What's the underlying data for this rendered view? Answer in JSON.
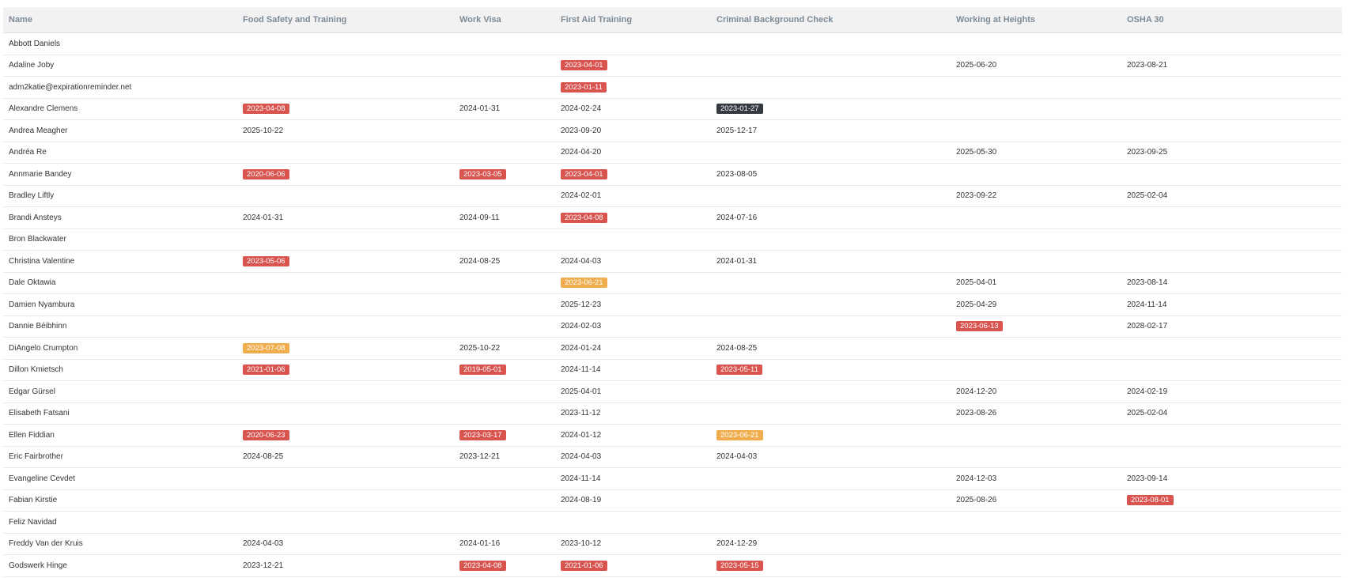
{
  "columns": [
    "Name",
    "Food Safety and Training",
    "Work Visa",
    "First Aid Training",
    "Criminal Background Check",
    "Working at Heights",
    "OSHA 30"
  ],
  "colors": {
    "red": "#d9534f",
    "orange": "#f0ad4e",
    "dark": "#343a40"
  },
  "rows": [
    {
      "name": "Abbott Daniels",
      "cells": [
        null,
        null,
        null,
        null,
        null,
        null
      ]
    },
    {
      "name": "Adaline Joby",
      "cells": [
        null,
        null,
        {
          "v": "2023-04-01",
          "s": "red"
        },
        null,
        {
          "v": "2025-06-20"
        },
        {
          "v": "2023-08-21"
        }
      ]
    },
    {
      "name": "adm2katie@expirationreminder.net",
      "cells": [
        null,
        null,
        {
          "v": "2023-01-11",
          "s": "red"
        },
        null,
        null,
        null
      ]
    },
    {
      "name": "Alexandre Clemens",
      "cells": [
        {
          "v": "2023-04-08",
          "s": "red"
        },
        {
          "v": "2024-01-31"
        },
        {
          "v": "2024-02-24"
        },
        {
          "v": "2023-01-27",
          "s": "dark"
        },
        null,
        null
      ]
    },
    {
      "name": "Andrea Meagher",
      "cells": [
        {
          "v": "2025-10-22"
        },
        null,
        {
          "v": "2023-09-20"
        },
        {
          "v": "2025-12-17"
        },
        null,
        null
      ]
    },
    {
      "name": "Andréa Re",
      "cells": [
        null,
        null,
        {
          "v": "2024-04-20"
        },
        null,
        {
          "v": "2025-05-30"
        },
        {
          "v": "2023-09-25"
        }
      ]
    },
    {
      "name": "Annmarie Bandey",
      "cells": [
        {
          "v": "2020-06-06",
          "s": "red"
        },
        {
          "v": "2023-03-05",
          "s": "red"
        },
        {
          "v": "2023-04-01",
          "s": "red"
        },
        {
          "v": "2023-08-05"
        },
        null,
        null
      ]
    },
    {
      "name": "Bradley Liftly",
      "cells": [
        null,
        null,
        {
          "v": "2024-02-01"
        },
        null,
        {
          "v": "2023-09-22"
        },
        {
          "v": "2025-02-04"
        }
      ]
    },
    {
      "name": "Brandi Ansteys",
      "cells": [
        {
          "v": "2024-01-31"
        },
        {
          "v": "2024-09-11"
        },
        {
          "v": "2023-04-08",
          "s": "red"
        },
        {
          "v": "2024-07-16"
        },
        null,
        null
      ]
    },
    {
      "name": "Bron Blackwater",
      "cells": [
        null,
        null,
        null,
        null,
        null,
        null
      ]
    },
    {
      "name": "Christina Valentine",
      "cells": [
        {
          "v": "2023-05-06",
          "s": "red"
        },
        {
          "v": "2024-08-25"
        },
        {
          "v": "2024-04-03"
        },
        {
          "v": "2024-01-31"
        },
        null,
        null
      ]
    },
    {
      "name": "Dale Oktawia",
      "cells": [
        null,
        null,
        {
          "v": "2023-06-21",
          "s": "orange"
        },
        null,
        {
          "v": "2025-04-01"
        },
        {
          "v": "2023-08-14"
        }
      ]
    },
    {
      "name": "Damien Nyambura",
      "cells": [
        null,
        null,
        {
          "v": "2025-12-23"
        },
        null,
        {
          "v": "2025-04-29"
        },
        {
          "v": "2024-11-14"
        }
      ]
    },
    {
      "name": "Dannie Béibhinn",
      "cells": [
        null,
        null,
        {
          "v": "2024-02-03"
        },
        null,
        {
          "v": "2023-06-13",
          "s": "red"
        },
        {
          "v": "2028-02-17"
        }
      ]
    },
    {
      "name": "DiAngelo Crumpton",
      "cells": [
        {
          "v": "2023-07-08",
          "s": "orange"
        },
        {
          "v": "2025-10-22"
        },
        {
          "v": "2024-01-24"
        },
        {
          "v": "2024-08-25"
        },
        null,
        null
      ]
    },
    {
      "name": "Dillon Kmietsch",
      "cells": [
        {
          "v": "2021-01-06",
          "s": "red"
        },
        {
          "v": "2019-05-01",
          "s": "red"
        },
        {
          "v": "2024-11-14"
        },
        {
          "v": "2023-05-11",
          "s": "red"
        },
        null,
        null
      ]
    },
    {
      "name": "Edgar Gürsel",
      "cells": [
        null,
        null,
        {
          "v": "2025-04-01"
        },
        null,
        {
          "v": "2024-12-20"
        },
        {
          "v": "2024-02-19"
        }
      ]
    },
    {
      "name": "Elisabeth Fatsani",
      "cells": [
        null,
        null,
        {
          "v": "2023-11-12"
        },
        null,
        {
          "v": "2023-08-26"
        },
        {
          "v": "2025-02-04"
        }
      ]
    },
    {
      "name": "Ellen Fiddian",
      "cells": [
        {
          "v": "2020-06-23",
          "s": "red"
        },
        {
          "v": "2023-03-17",
          "s": "red"
        },
        {
          "v": "2024-01-12"
        },
        {
          "v": "2023-06-21",
          "s": "orange"
        },
        null,
        null
      ]
    },
    {
      "name": "Eric Fairbrother",
      "cells": [
        {
          "v": "2024-08-25"
        },
        {
          "v": "2023-12-21"
        },
        {
          "v": "2024-04-03"
        },
        {
          "v": "2024-04-03"
        },
        null,
        null
      ]
    },
    {
      "name": "Evangeline Cevdet",
      "cells": [
        null,
        null,
        {
          "v": "2024-11-14"
        },
        null,
        {
          "v": "2024-12-03"
        },
        {
          "v": "2023-09-14"
        }
      ]
    },
    {
      "name": "Fabian Kirstie",
      "cells": [
        null,
        null,
        {
          "v": "2024-08-19"
        },
        null,
        {
          "v": "2025-08-26"
        },
        {
          "v": "2023-08-01",
          "s": "red"
        }
      ]
    },
    {
      "name": "Feliz Navidad",
      "cells": [
        null,
        null,
        null,
        null,
        null,
        null
      ]
    },
    {
      "name": "Freddy Van der Kruis",
      "cells": [
        {
          "v": "2024-04-03"
        },
        {
          "v": "2024-01-16"
        },
        {
          "v": "2023-10-12"
        },
        {
          "v": "2024-12-29"
        },
        null,
        null
      ]
    },
    {
      "name": "Godswerk Hinge",
      "cells": [
        {
          "v": "2023-12-21"
        },
        {
          "v": "2023-04-08",
          "s": "red"
        },
        {
          "v": "2021-01-06",
          "s": "red"
        },
        {
          "v": "2023-05-15",
          "s": "red"
        },
        null,
        null
      ]
    }
  ]
}
